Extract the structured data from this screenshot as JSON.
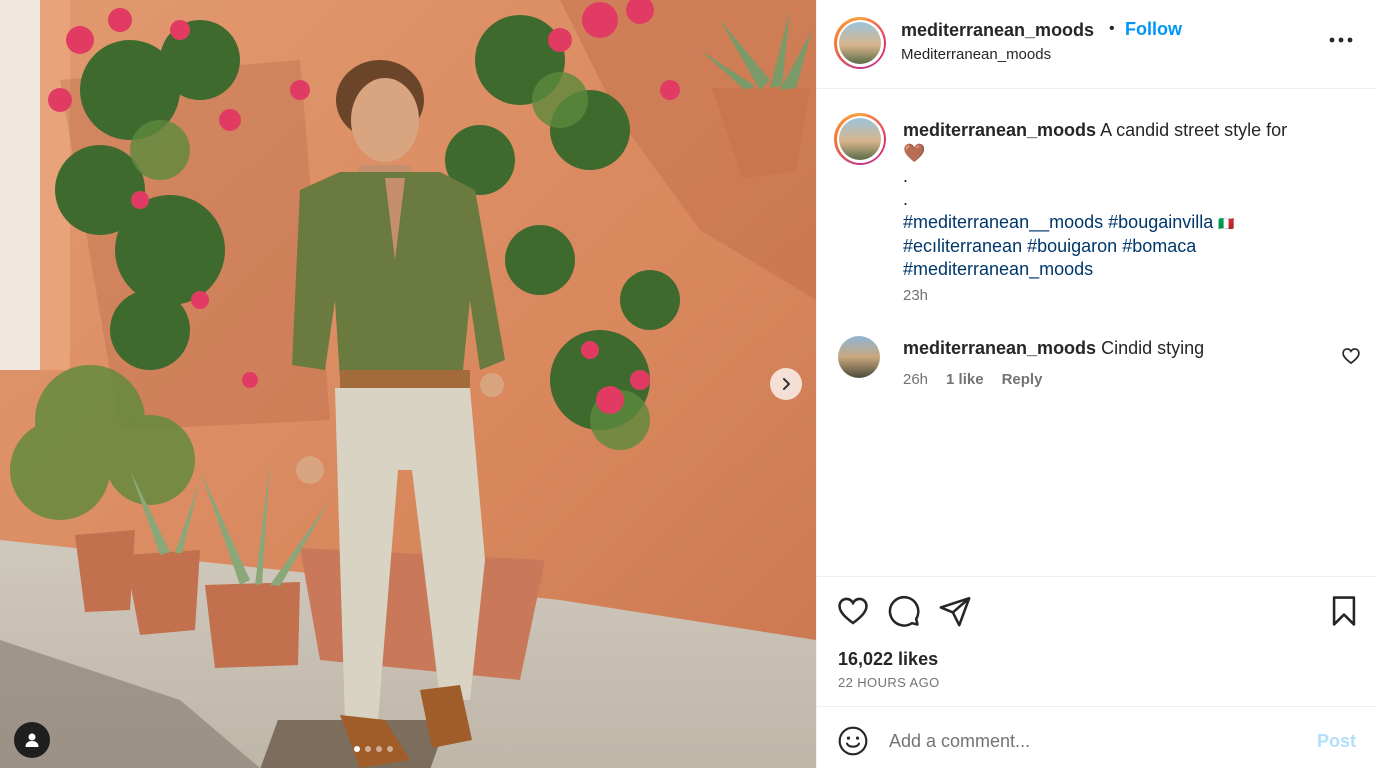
{
  "post": {
    "username": "mediterranean_moods",
    "separator": "•",
    "follow_label": "Follow",
    "location": "Mediterranean_moods",
    "carousel_total": 4,
    "carousel_active": 1
  },
  "caption": {
    "username": "mediterranean_moods",
    "text": "A candid street style for",
    "emoji": "🤎",
    "dot1": ".",
    "dot2": ".",
    "hashtags_line1": [
      "#mediterranean__moods",
      "#bougainvilla"
    ],
    "flag": "🇮🇹",
    "hashtags_line2": [
      "#ecıliterranean",
      "#bouigaron",
      "#bomaca"
    ],
    "hashtags_line3": [
      "#mediterranean_moods"
    ],
    "time": "23h"
  },
  "comment": {
    "username": "mediterranean_moods",
    "text": "Cindid stying",
    "time": "26h",
    "likes": "1 like",
    "reply_label": "Reply"
  },
  "stats": {
    "likes": "16,022 likes",
    "time_ago": "22 HOURS AGO"
  },
  "composer": {
    "placeholder": "Add a comment...",
    "post_label": "Post"
  },
  "icons": {
    "like": "heart-icon",
    "comment": "comment-icon",
    "share": "share-icon",
    "save": "bookmark-icon",
    "more": "more-options-icon",
    "emoji": "emoji-icon",
    "next": "chevron-right-icon",
    "tags": "user-tag-icon"
  },
  "colors": {
    "follow": "#0095f6",
    "hashtag": "#00376b",
    "post_disabled": "#b2dffc",
    "secondary_text": "#737373"
  }
}
